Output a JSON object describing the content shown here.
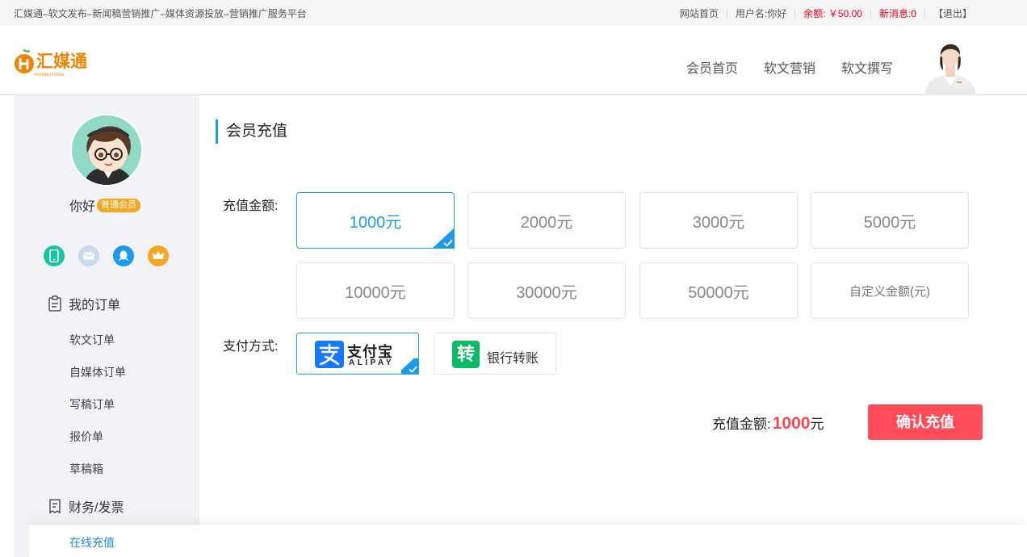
{
  "topbar": {
    "site_title": "汇媒通–软文发布–新闻稿营销推广–媒体资源投放–营销推广服务平台",
    "home": "网站首页",
    "user": "用户名:你好",
    "balance": "余额: ￥50.00",
    "messages": "新消息:0",
    "logout": "【退出】"
  },
  "header": {
    "logo_text": "汇媒通",
    "logo_sub": "HUIMEITONG",
    "nav": [
      "会员首页",
      "软文营销",
      "软文撰写"
    ]
  },
  "sidebar": {
    "username": "你好",
    "badge": "普通会员",
    "contact_icons": [
      "phone-icon",
      "email-icon",
      "qq-icon",
      "crown-icon"
    ],
    "group_orders": "我的订单",
    "order_items": [
      "软文订单",
      "自媒体订单",
      "写稿订单",
      "报价单",
      "草稿箱"
    ],
    "group_finance": "财务/发票",
    "active_item": "在线充值"
  },
  "main": {
    "title": "会员充值",
    "amount_label": "充值金额:",
    "amounts": [
      "1000元",
      "2000元",
      "3000元",
      "5000元",
      "10000元",
      "30000元",
      "50000元",
      "自定义金额(元)"
    ],
    "selected_amount_index": 0,
    "pay_label": "支付方式:",
    "alipay_text": "支付宝",
    "alipay_sub": "ALIPAY",
    "bank_glyph": "转",
    "bank_label": "银行转账",
    "total_label": "充值金额:",
    "total_value": "1000",
    "total_unit": "元",
    "confirm": "确认充值"
  },
  "colors": {
    "accent": "#1e9be8",
    "red": "#ff4c58",
    "alipay": "#1677ff",
    "bank": "#09bb63",
    "logo": "#f08300"
  }
}
